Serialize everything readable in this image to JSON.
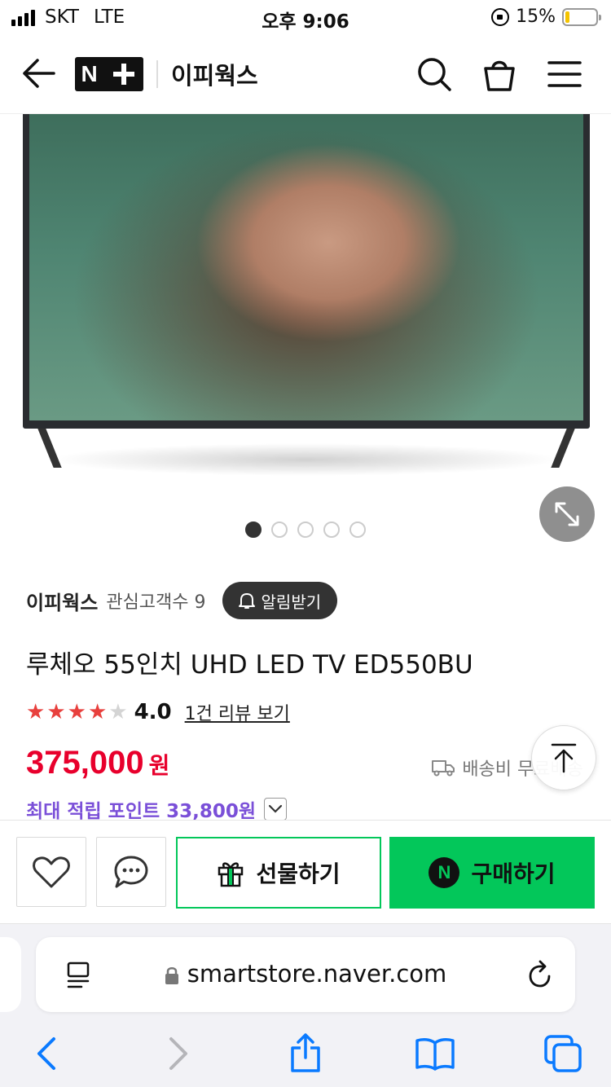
{
  "status_bar": {
    "carrier": "SKT",
    "network": "LTE",
    "time": "오후 9:06",
    "battery": "15%",
    "battery_level": 0.15
  },
  "header": {
    "logo_text": "N",
    "store_name": "이피웍스"
  },
  "gallery": {
    "image_count": 5,
    "active_index": 0
  },
  "product": {
    "store_name": "이피웍스",
    "followers": "관심고객수 9",
    "notify_label": "알림받기",
    "title": "루체오 55인치 UHD LED TV ED550BU",
    "rating": "4.0",
    "rating_value": 4.0,
    "review_link": "1건 리뷰 보기",
    "price": "375,000",
    "price_unit": "원",
    "shipping": "배송비 무료배송",
    "points": "최대 적립 포인트 33,800원"
  },
  "actions": {
    "gift_label": "선물하기",
    "buy_label": "구매하기",
    "buy_badge": "N"
  },
  "browser": {
    "url": "smartstore.naver.com"
  },
  "colors": {
    "price": "#e8002c",
    "points": "#7a4fd8",
    "naver_green": "#03c75a",
    "star": "#e8403d"
  }
}
